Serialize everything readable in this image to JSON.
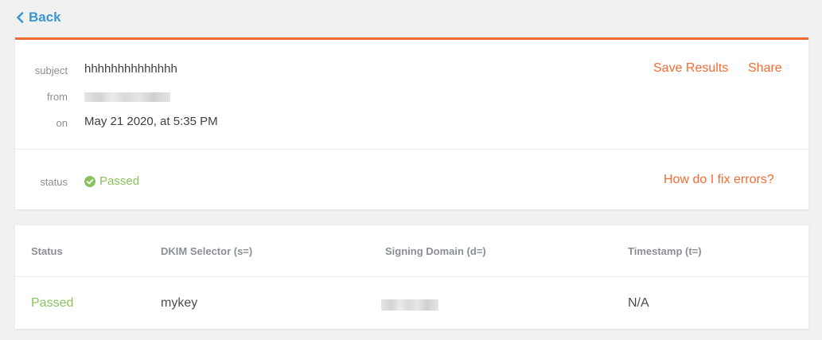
{
  "nav": {
    "back_label": "Back"
  },
  "summary": {
    "subject_label": "subject",
    "subject_value": "hhhhhhhhhhhhhh",
    "from_label": "from",
    "on_label": "on",
    "on_value": "May 21 2020, at 5:35 PM",
    "status_label": "status",
    "status_value": "Passed",
    "save_results_label": "Save Results",
    "share_label": "Share",
    "fix_errors_label": "How do I fix errors?"
  },
  "results": {
    "columns": [
      "Status",
      "DKIM Selector (s=)",
      "Signing Domain (d=)",
      "Timestamp (t=)"
    ],
    "rows": [
      {
        "status": "Passed",
        "selector": "mykey",
        "timestamp": "N/A"
      }
    ]
  },
  "colors": {
    "accent": "#f26b32",
    "link_blue": "#3a97d4",
    "success": "#8bc25c"
  },
  "icons": [
    "chevron-left-icon",
    "check-circle-icon"
  ]
}
